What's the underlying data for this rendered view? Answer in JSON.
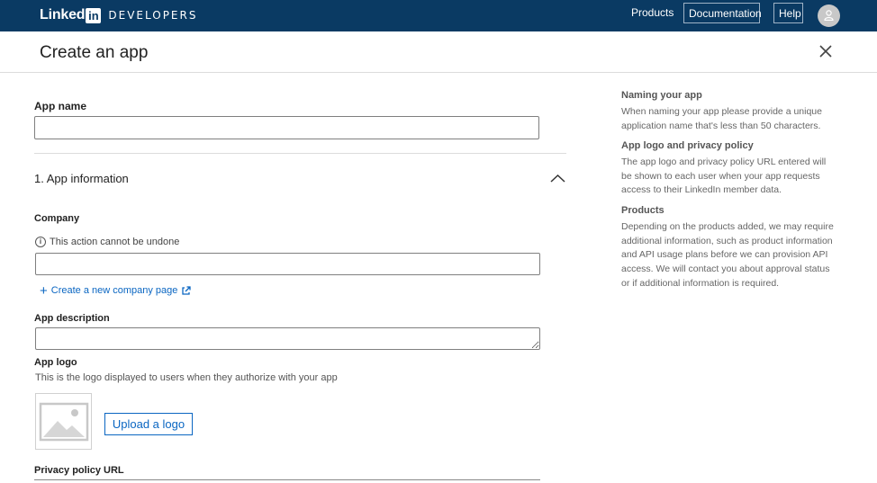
{
  "nav": {
    "brand_linked": "Linked",
    "brand_in": "in",
    "brand_developers": "DEVELOPERS",
    "products": "Products",
    "documentation": "Documentation",
    "help": "Help"
  },
  "header": {
    "title": "Create an app"
  },
  "form": {
    "app_name_label": "App name",
    "app_name_value": "",
    "section_title": "1. App information",
    "company_label": "Company",
    "company_warning": "This action cannot be undone",
    "company_value": "",
    "create_company_link": "Create a new company page",
    "app_description_label": "App description",
    "app_description_value": "",
    "app_logo_label": "App logo",
    "app_logo_help": "This is the logo displayed to users when they authorize with your app",
    "upload_logo_button": "Upload a logo",
    "privacy_policy_label": "Privacy policy URL"
  },
  "sidebar": {
    "sections": [
      {
        "heading": "Naming your app",
        "text": "When naming your app please provide a unique application name that's less than 50 characters."
      },
      {
        "heading": "App logo and privacy policy",
        "text": "The app logo and privacy policy URL entered will be shown to each user when your app requests access to their LinkedIn member data."
      },
      {
        "heading": "Products",
        "text": "Depending on the products added, we may require additional information, such as product information and API usage plans before we can provision API access. We will contact you about approval status or if additional information is required."
      }
    ]
  },
  "colors": {
    "nav_bg": "#0a3a63",
    "link": "#0a66c2"
  },
  "icons": [
    "linkedin-logo",
    "user-icon",
    "close-icon",
    "chevron-up-icon",
    "info-icon",
    "plus-icon",
    "external-link-icon",
    "image-placeholder-icon"
  ]
}
